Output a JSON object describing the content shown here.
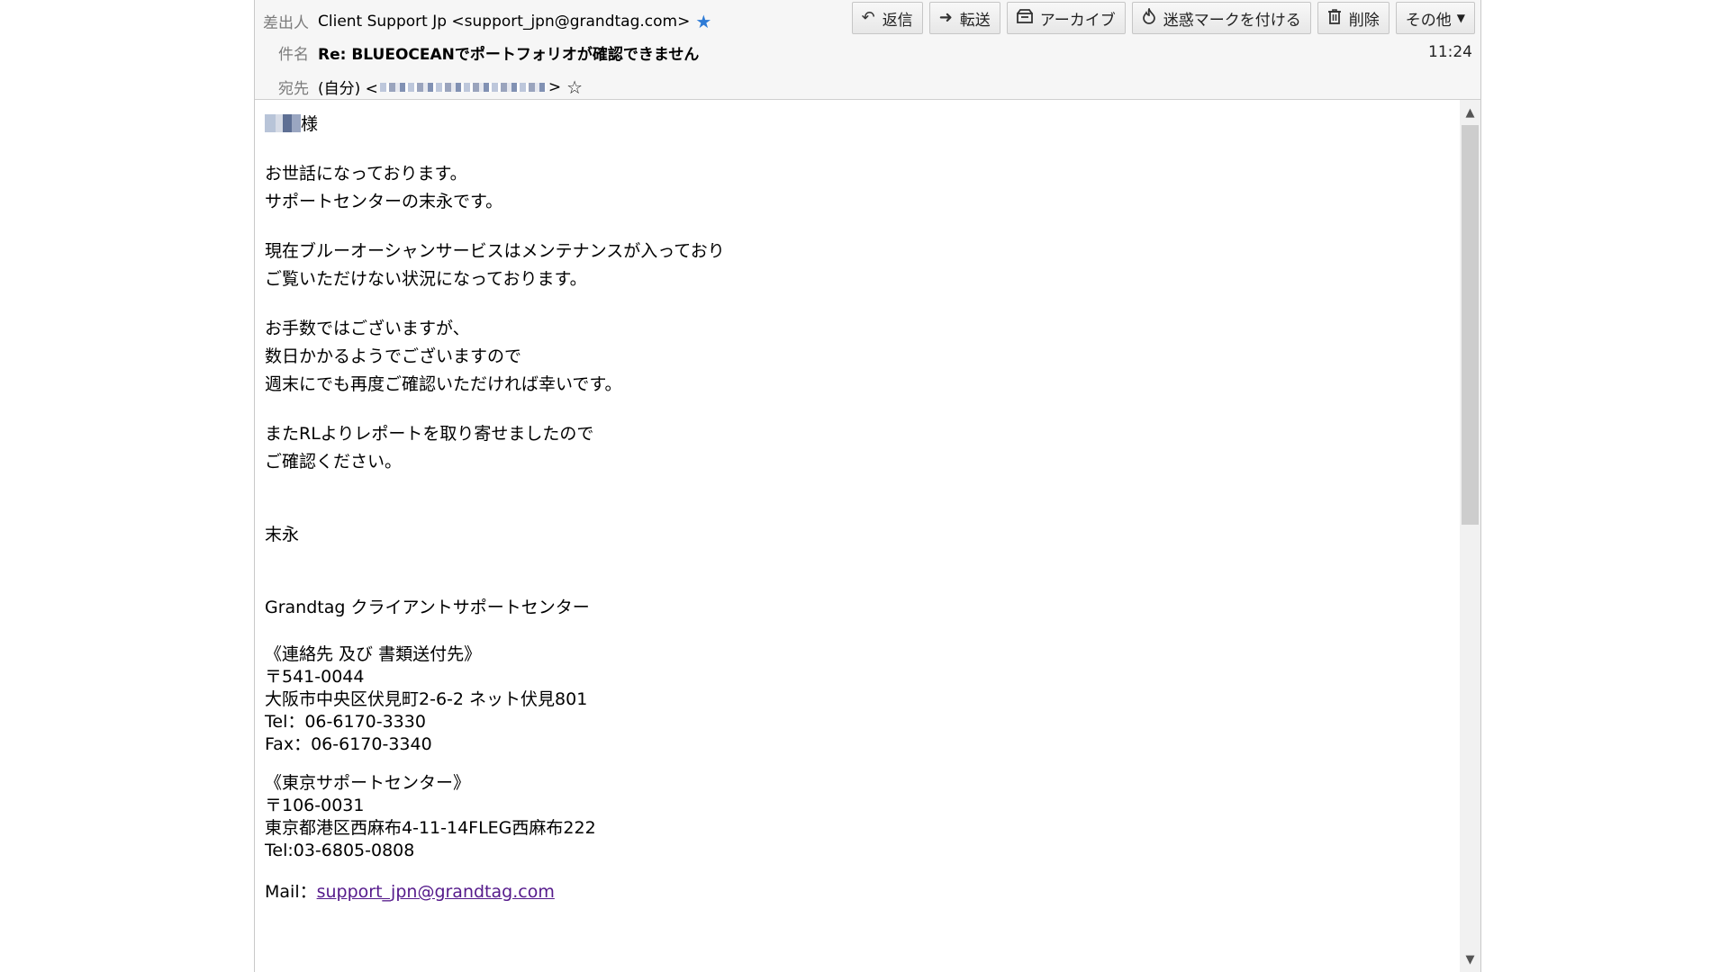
{
  "header": {
    "from_label": "差出人",
    "from_value": "Client Support Jp <support_jpn@grandtag.com>",
    "subject_label": "件名",
    "subject_value": "Re: BLUEOCEANでポートフォリオが確認できません",
    "to_label": "宛先",
    "to_prefix": "(自分) <",
    "to_suffix": ">",
    "time": "11:24"
  },
  "toolbar": {
    "reply": "返信",
    "forward": "転送",
    "archive": "アーカイブ",
    "junk": "迷惑マークを付ける",
    "delete": "削除",
    "other": "その他"
  },
  "body": {
    "salutation_suffix": "様",
    "p1": [
      "お世話になっております。",
      "サポートセンターの末永です。"
    ],
    "p2": [
      "現在ブルーオーシャンサービスはメンテナンスが入っており",
      "ご覧いただけない状況になっております。"
    ],
    "p3": [
      "お手数ではございますが、",
      "数日かかるようでございますので",
      "週末にでも再度ご確認いただければ幸いです。"
    ],
    "p4": [
      "またRLよりレポートを取り寄せましたので",
      "ご確認ください。"
    ],
    "sign_name": "末永",
    "company": "Grandtag クライアントサポートセンター",
    "osaka": [
      "《連絡先 及び 書類送付先》",
      "〒541-0044",
      "大阪市中央区伏見町2-6-2 ネット伏見801",
      "Tel：06-6170-3330",
      "Fax：06-6170-3340"
    ],
    "tokyo": [
      "《東京サポートセンター》",
      "〒106-0031",
      "東京都港区西麻布4-11-14FLEG西麻布222",
      "Tel:03-6805-0808"
    ],
    "mail_label": "Mail：",
    "mail_link": "support_jpn@grandtag.com"
  },
  "icons": {
    "reply": "reply-icon",
    "forward": "forward-icon",
    "archive": "archive-icon",
    "junk": "flame-icon",
    "delete": "trash-icon",
    "other": "chevron-down-icon"
  },
  "colors": {
    "star": "#2e7bd6",
    "link": "#551a8b"
  }
}
